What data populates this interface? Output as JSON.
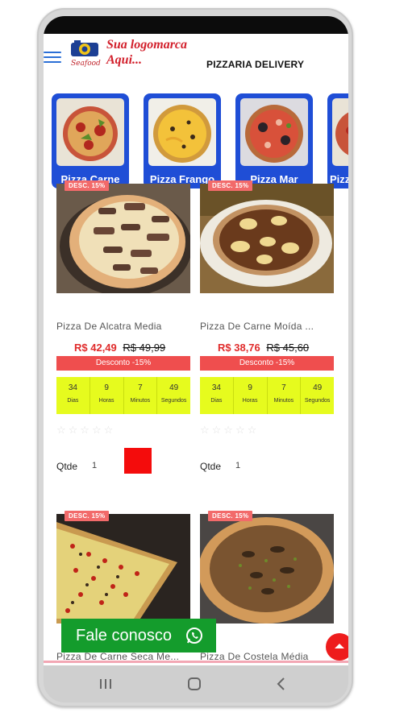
{
  "header": {
    "logo_text_line1": "Sua logomarca",
    "logo_text_line2": "Aqui...",
    "logo_sub": "Seafood",
    "title": "PIZZARIA DELIVERY"
  },
  "categories": [
    {
      "label": "Pizza Carne"
    },
    {
      "label": "Pizza Frango"
    },
    {
      "label": "Pizza Mar"
    },
    {
      "label": "Pizz"
    }
  ],
  "products": [
    {
      "badge": "DESC. 15%",
      "name": "Pizza De Alcatra Media",
      "price": "R$ 42,49",
      "old_price": "R$ 49,99",
      "discount": "Desconto -15%",
      "countdown": [
        {
          "value": "34",
          "unit": "Dias"
        },
        {
          "value": "9",
          "unit": "Horas"
        },
        {
          "value": "7",
          "unit": "Minutos"
        },
        {
          "value": "49",
          "unit": "Segundos"
        }
      ],
      "qty_label": "Qtde",
      "qty": "1"
    },
    {
      "badge": "DESC. 15%",
      "name": "Pizza De Carne Moída ...",
      "price": "R$ 38,76",
      "old_price": "R$ 45,60",
      "discount": "Desconto -15%",
      "countdown": [
        {
          "value": "34",
          "unit": "Dias"
        },
        {
          "value": "9",
          "unit": "Horas"
        },
        {
          "value": "7",
          "unit": "Minutos"
        },
        {
          "value": "49",
          "unit": "Segundos"
        }
      ],
      "qty_label": "Qtde",
      "qty": "1"
    },
    {
      "badge": "DESC. 15%",
      "name": "Pizza De Carne Seca Me..."
    },
    {
      "badge": "DESC. 15%",
      "name": "Pizza De Costela Média"
    }
  ],
  "contact_button": {
    "label": "Fale conosco"
  },
  "colors": {
    "category_blue": "#1f4ed6",
    "price_red": "#e02b2b",
    "countdown_yellow": "#e6fb1e",
    "whatsapp_green": "#149c2c"
  }
}
